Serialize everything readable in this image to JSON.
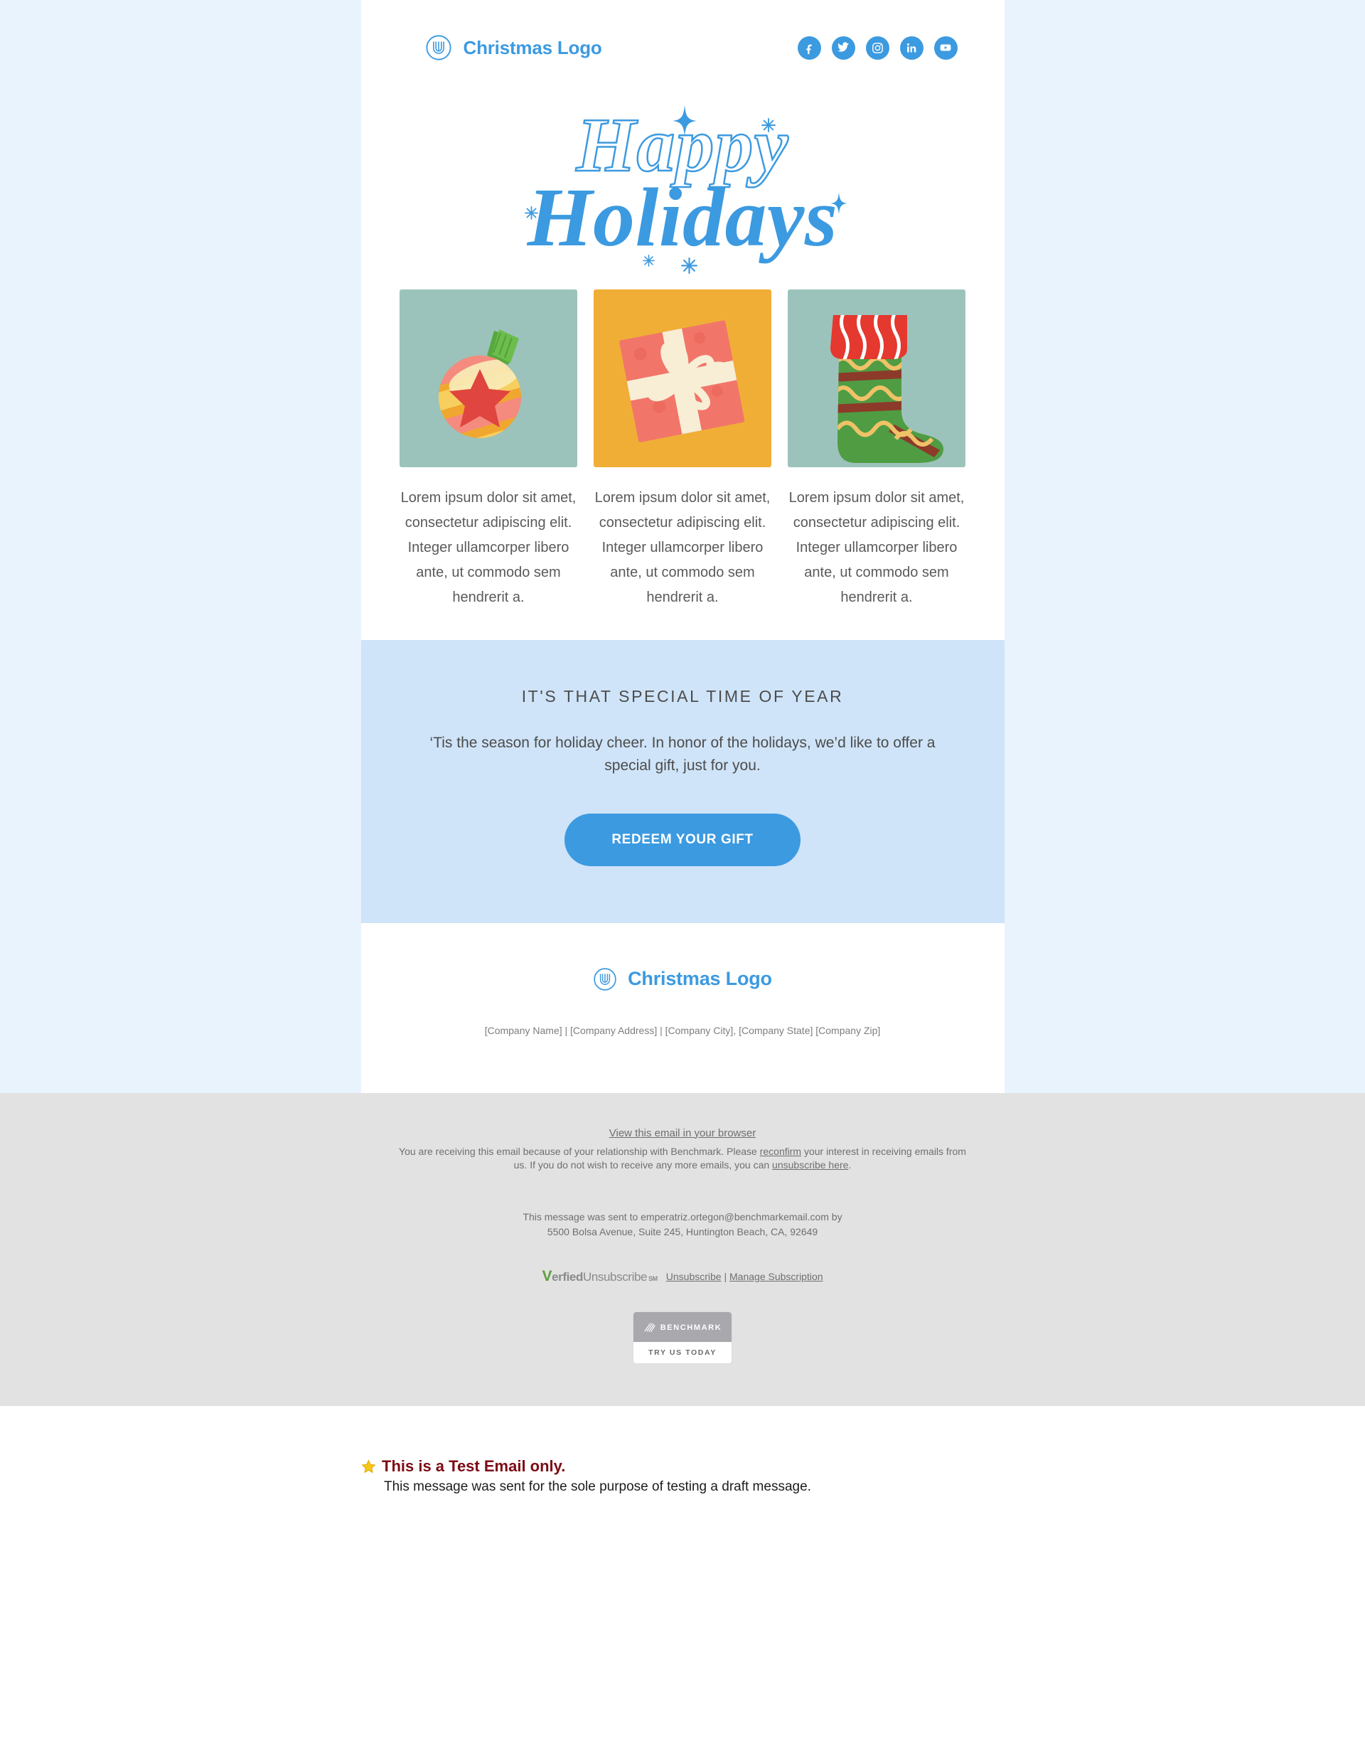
{
  "colors": {
    "page_bg": "#e9f3fd",
    "brand_blue": "#3c9ae0",
    "cta_band": "#cfe4f8",
    "legal_band": "#e2e2e2",
    "notice_red": "#7c0b14",
    "star_gold": "#f5c518"
  },
  "header": {
    "logo_icon": "christmas-logo-mark",
    "brand_name": "Christmas Logo",
    "socials": [
      {
        "name": "facebook",
        "icon": "facebook-icon"
      },
      {
        "name": "twitter",
        "icon": "twitter-icon"
      },
      {
        "name": "instagram",
        "icon": "instagram-icon"
      },
      {
        "name": "linkedin",
        "icon": "linkedin-icon"
      },
      {
        "name": "youtube",
        "icon": "youtube-icon"
      }
    ]
  },
  "hero": {
    "line1": "Happy",
    "line2": "Holidays",
    "decorations": [
      "sparkle-4point",
      "sparkle-asterisk",
      "sparkle-asterisk",
      "sparkle-4point",
      "sparkle-asterisk",
      "sparkle-asterisk"
    ]
  },
  "cards": [
    {
      "image_name": "christmas-ornament-illustration",
      "bg": "#9cc3bb",
      "text": "Lorem ipsum dolor sit amet, consectetur adipiscing elit. Integer ullamcorper libero ante, ut commodo sem hendrerit a."
    },
    {
      "image_name": "gift-box-illustration",
      "bg": "#f0ae36",
      "text": "Lorem ipsum dolor sit amet, consectetur adipiscing elit. Integer ullamcorper libero ante, ut commodo sem hendrerit a."
    },
    {
      "image_name": "christmas-stocking-illustration",
      "bg": "#9cc3bb",
      "text": "Lorem ipsum dolor sit amet, consectetur adipiscing elit. Integer ullamcorper libero ante, ut commodo sem hendrerit a."
    }
  ],
  "cta": {
    "heading": "IT'S THAT SPECIAL TIME OF YEAR",
    "body": "‘Tis the season for holiday cheer. In honor of the holidays, we’d like to offer a special gift, just for you.",
    "button_label": "REDEEM YOUR GIFT"
  },
  "email_footer": {
    "logo_icon": "christmas-logo-mark",
    "brand_name": "Christmas Logo",
    "address": "[Company Name] | [Company Address] | [Company City], [Company State] [Company Zip]"
  },
  "legal": {
    "view_in_browser": "View this email in your browser",
    "paragraph_a": "You are receiving this email because of your relationship with Benchmark. Please ",
    "reconfirm_link": "reconfirm",
    "paragraph_b": " your interest in receiving emails from us. If you do not wish to receive any more emails, you can ",
    "unsubscribe_link": "unsubscribe here",
    "paragraph_c": ".",
    "sent_line1": "This message was sent to emperatriz.ortegon@benchmarkemail.com by",
    "sent_line2": "5500 Bolsa Avenue, Suite 245, Huntington Beach, CA, 92649",
    "verified_v": "V",
    "verified_word1": "erfied",
    "verified_word2": "Unsubscribe",
    "verified_sm": "SM",
    "unsubscribe_label": "Unsubscribe",
    "separator": "|",
    "manage_label": "Manage Subscription",
    "badge_word": "BENCHMARK",
    "badge_cta": "TRY US TODAY",
    "badge_icon": "benchmark-slashes-icon"
  },
  "notice": {
    "star_icon": "star-icon",
    "title": "This is a Test Email only.",
    "subtitle": "This message was sent for the sole purpose of testing a draft message."
  }
}
